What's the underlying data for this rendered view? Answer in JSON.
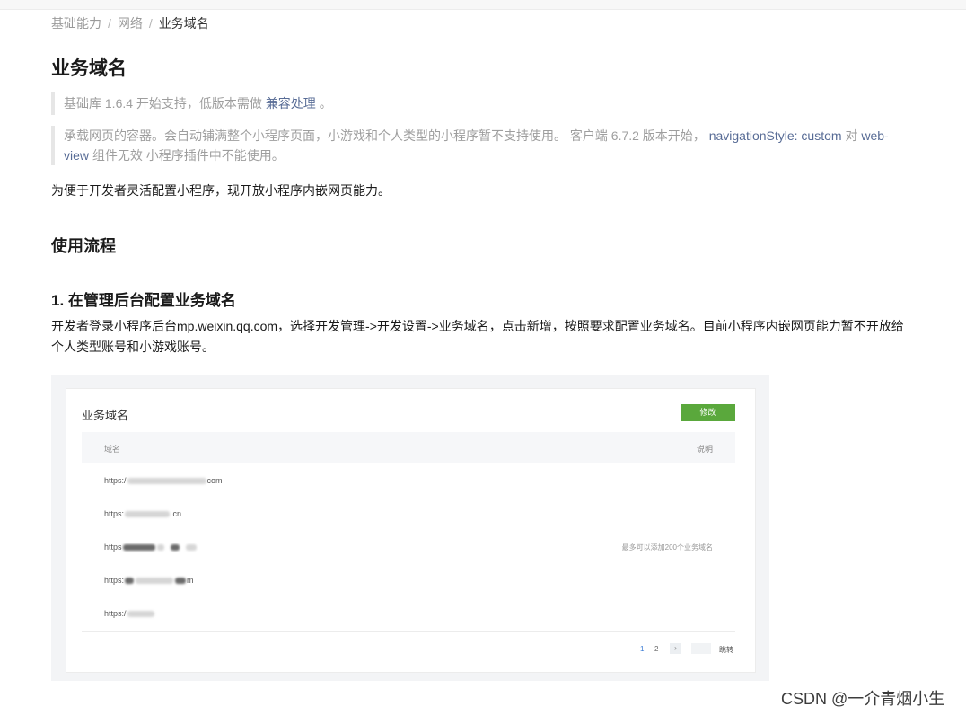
{
  "breadcrumb": {
    "item1": "基础能力",
    "item2": "网络",
    "current": "业务域名",
    "separator": "/"
  },
  "title": "业务域名",
  "note1": {
    "prefix": "基础库 1.6.4 开始支持，低版本需做",
    "link": "兼容处理",
    "suffix": "。"
  },
  "note2": {
    "text_a": "承载网页的容器。会自动铺满整个小程序页面，小游戏和个人类型的小程序暂不支持使用。 客户端 6.7.2 版本开始，",
    "code_a": "navigationStyle: custom",
    "text_b": "对",
    "code_b": "web-view",
    "text_c": "组件无效 小程序插件中不能使用。"
  },
  "intro": "为便于开发者灵活配置小程序，现开放小程序内嵌网页能力。",
  "section_heading": "使用流程",
  "step1": {
    "heading": "1. 在管理后台配置业务域名",
    "body": "开发者登录小程序后台mp.weixin.qq.com，选择开发管理->开发设置->业务域名，点击新增，按照要求配置业务域名。目前小程序内嵌网页能力暂不开放给个人类型账号和小游戏账号。"
  },
  "screenshot": {
    "card_title": "业务域名",
    "edit_button": "修改",
    "col_domain": "域名",
    "col_desc": "说明",
    "rows": [
      {
        "prefix": "https:/",
        "suffix": "com"
      },
      {
        "prefix": "https:",
        "suffix": ".cn"
      },
      {
        "prefix": "https",
        "suffix": ""
      },
      {
        "prefix": "https:",
        "suffix": "m"
      },
      {
        "prefix": "https:/",
        "suffix": ""
      }
    ],
    "note": "最多可以添加200个业务域名",
    "pagination": {
      "page1": "1",
      "page2": "2",
      "next": "›",
      "jump": "跳转"
    }
  },
  "watermark": "CSDN @一介青烟小生"
}
